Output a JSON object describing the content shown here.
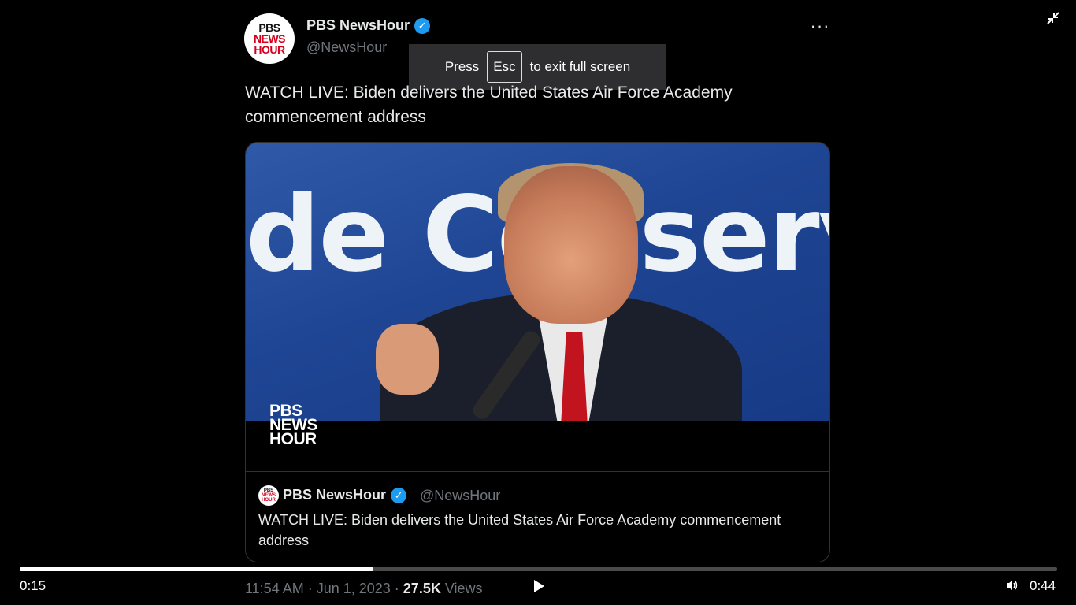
{
  "tweet": {
    "avatar_lines": [
      "PBS",
      "NEWS",
      "HOUR"
    ],
    "author_name": "PBS NewsHour",
    "author_handle": "@NewsHour",
    "verified_mark": "✓",
    "more_label": "···",
    "text": "WATCH LIVE: Biden delivers the United States Air Force Academy commencement address",
    "timestamp": "11:54 AM · Jun 1, 2023 · ",
    "views_count": "27.5K",
    "views_label": " Views"
  },
  "fullscreen_toast": {
    "press": "Press",
    "key": "Esc",
    "suffix": "to exit full screen"
  },
  "video": {
    "banner_text": "de Conservativ",
    "watermark_lines": [
      "PBS",
      "NEWS",
      "HOUR"
    ]
  },
  "quoted_tweet": {
    "author_name": "PBS NewsHour",
    "author_handle": "@NewsHour",
    "text": "WATCH LIVE: Biden delivers the United States Air Force Academy commencement address"
  },
  "player": {
    "current_time": "0:15",
    "duration": "0:44",
    "progress_fraction": 0.341,
    "icons": {
      "play": "play-icon",
      "volume": "volume-icon",
      "exit_fullscreen": "exit-fullscreen-icon"
    }
  },
  "colors": {
    "accent": "#1d9bf0",
    "background": "#000000",
    "muted_text": "#71767b",
    "pbs_red": "#d6001c"
  }
}
